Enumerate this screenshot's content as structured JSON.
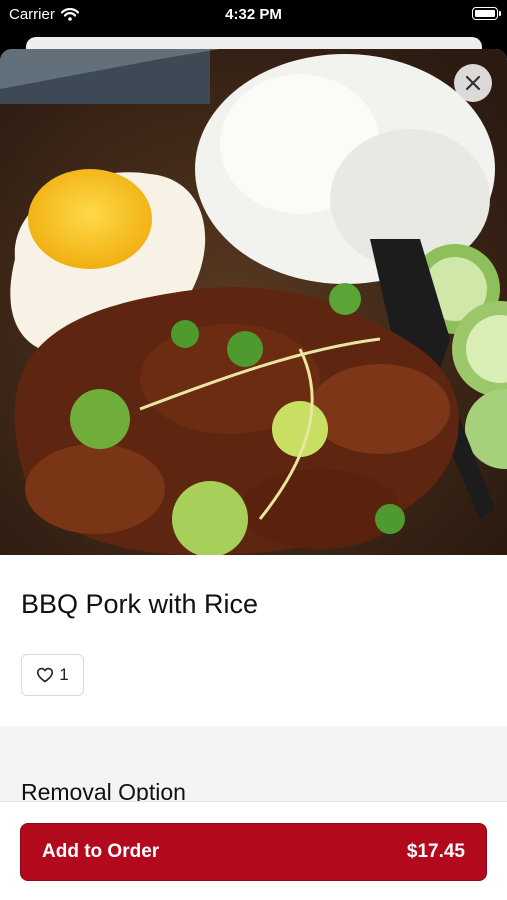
{
  "status_bar": {
    "carrier": "Carrier",
    "time": "4:32 PM"
  },
  "item": {
    "title": "BBQ Pork with Rice",
    "likes": "1"
  },
  "section": {
    "title": "Removal Option"
  },
  "footer": {
    "button_label": "Add to Order",
    "price": "$17.45"
  },
  "colors": {
    "accent": "#b3091d"
  }
}
